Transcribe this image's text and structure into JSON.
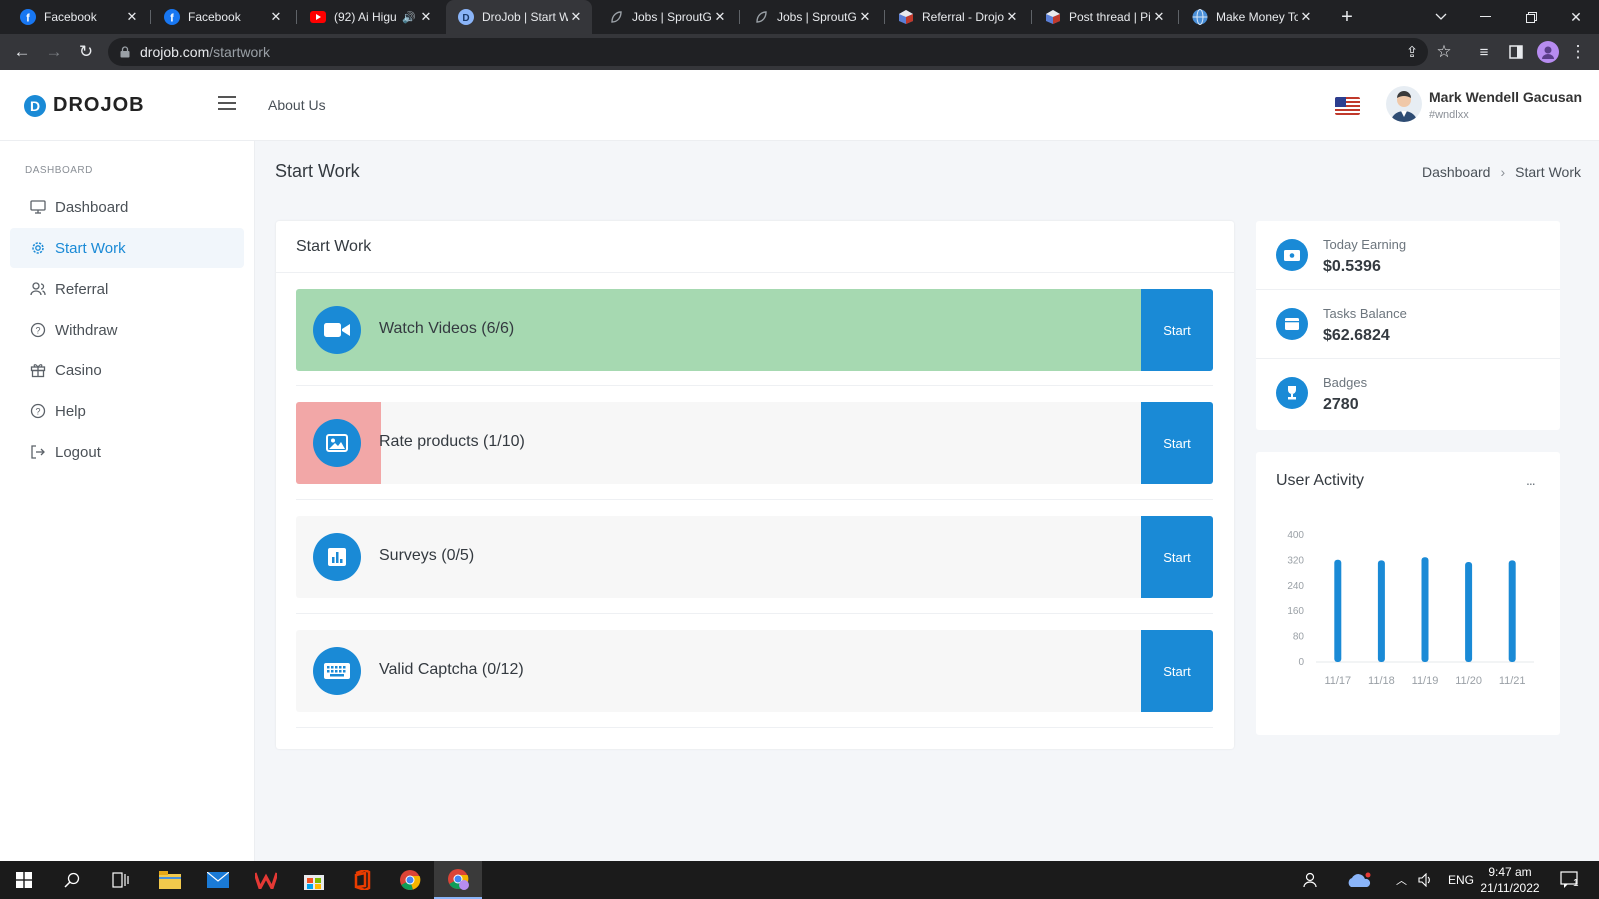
{
  "browser": {
    "tabs": [
      {
        "title": "Facebook",
        "icon": "facebook-icon",
        "muted": false
      },
      {
        "title": "Facebook",
        "icon": "facebook-icon",
        "muted": false
      },
      {
        "title": "(92) Ai Higu",
        "icon": "youtube-icon",
        "muted": true
      },
      {
        "title": "DroJob | Start W",
        "icon": "drojob-icon",
        "muted": false
      },
      {
        "title": "Jobs | SproutGi",
        "icon": "sproutgigs-icon",
        "muted": false
      },
      {
        "title": "Jobs | SproutGi",
        "icon": "sproutgigs-icon",
        "muted": false
      },
      {
        "title": "Referral - Drojo",
        "icon": "drojob-cube-icon",
        "muted": false
      },
      {
        "title": "Post thread | Pi",
        "icon": "drojob-cube-icon",
        "muted": false
      },
      {
        "title": "Make Money To",
        "icon": "globe-icon",
        "muted": false
      }
    ],
    "active_tab_index": 3,
    "url_host": "drojob.com",
    "url_path": "/startwork"
  },
  "app": {
    "logo_text": "DROJOB",
    "logo_letter": "D",
    "about_us": "About Us",
    "user_name": "Mark Wendell Gacusan",
    "user_handle": "#wndlxx"
  },
  "sidebar": {
    "heading": "DASHBOARD",
    "items": [
      {
        "label": "Dashboard",
        "icon": "monitor-icon",
        "active": false
      },
      {
        "label": "Start Work",
        "icon": "gear-icon",
        "active": true
      },
      {
        "label": "Referral",
        "icon": "users-icon",
        "active": false
      },
      {
        "label": "Withdraw",
        "icon": "help-circle-icon",
        "active": false
      },
      {
        "label": "Casino",
        "icon": "gift-icon",
        "active": false
      },
      {
        "label": "Help",
        "icon": "help-circle-icon",
        "active": false
      },
      {
        "label": "Logout",
        "icon": "logout-icon",
        "active": false
      }
    ]
  },
  "page": {
    "title": "Start Work",
    "breadcrumb": [
      "Dashboard",
      "Start Work"
    ],
    "card_title": "Start Work"
  },
  "tasks": [
    {
      "label": "Watch Videos (6/6)",
      "button": "Start",
      "icon": "video-icon",
      "progress": 1.0,
      "fill_color": "#a6d9b1"
    },
    {
      "label": "Rate products (1/10)",
      "button": "Start",
      "icon": "image-icon",
      "progress": 0.1,
      "fill_color": "#f2a7a7"
    },
    {
      "label": "Surveys (0/5)",
      "button": "Start",
      "icon": "bar-chart-icon",
      "progress": 0,
      "fill_color": "#f2a7a7"
    },
    {
      "label": "Valid Captcha (0/12)",
      "button": "Start",
      "icon": "keyboard-icon",
      "progress": 0,
      "fill_color": "#f2a7a7"
    }
  ],
  "stats": [
    {
      "title": "Today Earning",
      "value": "$0.5396",
      "icon": "money-icon"
    },
    {
      "title": "Tasks Balance",
      "value": "$62.6824",
      "icon": "wallet-icon"
    },
    {
      "title": "Badges",
      "value": "2780",
      "icon": "trophy-icon"
    }
  ],
  "activity": {
    "title": "User Activity",
    "menu": "..."
  },
  "chart_data": {
    "type": "bar",
    "title": "User Activity",
    "categories": [
      "11/17",
      "11/18",
      "11/19",
      "11/20",
      "11/21"
    ],
    "values": [
      322,
      320,
      330,
      315,
      320
    ],
    "yticks": [
      "400",
      "320",
      "240",
      "160",
      "80",
      "0"
    ],
    "ylim": [
      0,
      400
    ],
    "color": "#1a8ad6"
  },
  "taskbar": {
    "time": "9:47 am",
    "date": "21/11/2022",
    "lang": "ENG",
    "notifications": "1"
  },
  "colors": {
    "accent": "#1a8ad6",
    "done_fill": "#a6d9b1",
    "partial_fill": "#f2a7a7"
  }
}
